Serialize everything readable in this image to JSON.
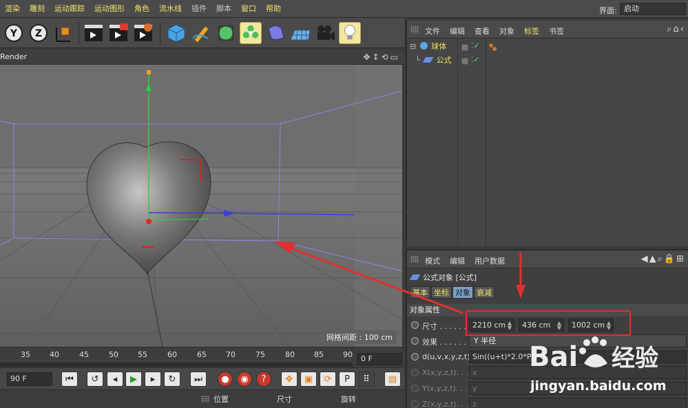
{
  "menu": {
    "items": [
      "渲染",
      "雕刻",
      "运动跟踪",
      "运动图形",
      "角色",
      "流水线",
      "插件",
      "脚本",
      "窗口",
      "帮助"
    ],
    "layout_label": "界面:",
    "layout_value": "启动"
  },
  "toolbar": {
    "tools": [
      "y-axis-icon",
      "z-axis-icon",
      "coordinate-system-icon",
      "render-view-icon",
      "render-picture-viewer-icon",
      "render-settings-icon",
      "cube-icon",
      "pen-icon",
      "subdivision-icon",
      "array-icon",
      "deformer-icon",
      "floor-icon",
      "camera-icon",
      "light-icon"
    ]
  },
  "viewport": {
    "title": "Render",
    "grid_spacing": "网格间距 : 100 cm"
  },
  "timeline": {
    "ticks": [
      "35",
      "40",
      "45",
      "50",
      "55",
      "60",
      "65",
      "70",
      "75",
      "80",
      "85",
      "90"
    ],
    "current_frame": "0 F"
  },
  "playback": {
    "end_frame": "90 F"
  },
  "coords": {
    "headers": [
      "位置",
      "尺寸",
      "旋转"
    ]
  },
  "object_manager": {
    "menu": [
      "文件",
      "编辑",
      "查看",
      "对象",
      "标签",
      "书签"
    ],
    "active_menu": "标签",
    "objects": [
      {
        "name": "球体",
        "icon": "sphere-icon"
      },
      {
        "name": "公式",
        "icon": "formula-icon"
      }
    ]
  },
  "attribute_manager": {
    "menu": [
      "模式",
      "编辑",
      "用户数据"
    ],
    "title": "公式对象 [公式]",
    "tabs": [
      "基本",
      "坐标",
      "对象",
      "衰减"
    ],
    "active_tab": "对象",
    "section": "对象属性",
    "size_label": "尺寸 . . . . . .",
    "size_values": [
      "2210 cm",
      "436 cm",
      "1002 cm"
    ],
    "effect_label": "效果 . . . . . .",
    "effect_value": "Y 半径",
    "d_label": "d(u,v,x,y,z,t)",
    "d_value": "Sin((u+t)*2.0*PI)*0",
    "x_label": "X(x,y,z,t). . .",
    "x_value": "x",
    "y_label": "Y(x,y,z,t). . .",
    "y_value": "y",
    "z_label": "Z(x,y,z,t). . .",
    "z_value": "z"
  },
  "watermark": {
    "brand": "Bai du 经验",
    "url": "jingyan.baidu.com"
  },
  "colors": {
    "accent_yellow": "#f0e36a",
    "annotation_red": "#e03030"
  }
}
